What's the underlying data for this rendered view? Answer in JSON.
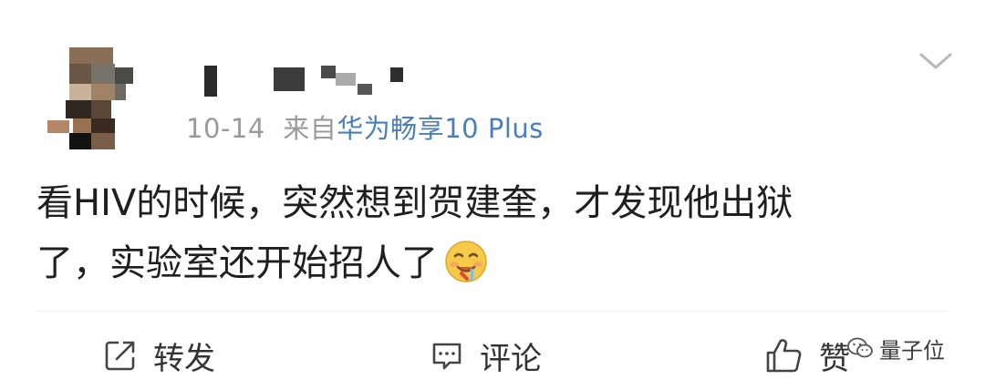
{
  "post": {
    "username_blurred": true,
    "date": "10-14",
    "source_prefix": "来自",
    "device": "华为畅享10 Plus",
    "text_line1": "看HIV的时候，突然想到贺建奎，才发现他出狱",
    "text_line2": "了，实验室还开始招人了",
    "emoji": "drooling-face-emoji"
  },
  "actions": {
    "repost_label": "转发",
    "comment_label": "评论",
    "like_label": "赞"
  },
  "watermark": {
    "label": "量子位"
  },
  "colors": {
    "device_link": "#4a7fb8",
    "meta_gray": "#9a9a9a",
    "divider": "#ececec"
  }
}
